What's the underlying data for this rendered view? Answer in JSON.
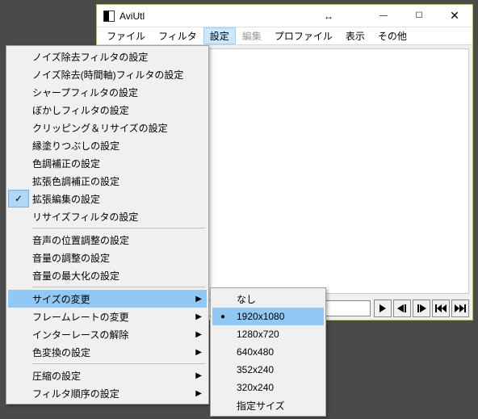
{
  "window": {
    "title": "AviUtl",
    "min_glyph": "—",
    "max_glyph": "☐",
    "close_glyph": "✕",
    "resize_glyph": "↔"
  },
  "menubar": {
    "items": [
      {
        "label": "ファイル",
        "disabled": false
      },
      {
        "label": "フィルタ",
        "disabled": false
      },
      {
        "label": "設定",
        "disabled": false,
        "active": true
      },
      {
        "label": "編集",
        "disabled": true
      },
      {
        "label": "プロファイル",
        "disabled": false
      },
      {
        "label": "表示",
        "disabled": false
      },
      {
        "label": "その他",
        "disabled": false
      }
    ]
  },
  "playback": {
    "play": "▶",
    "step_back": "◀|",
    "step_fwd": "|▶",
    "jump_start": "|◀",
    "jump_end": "▶|"
  },
  "dropdown": {
    "items": [
      {
        "label": "ノイズ除去フィルタの設定"
      },
      {
        "label": "ノイズ除去(時間軸)フィルタの設定"
      },
      {
        "label": "シャープフィルタの設定"
      },
      {
        "label": "ぼかしフィルタの設定"
      },
      {
        "label": "クリッピング＆リサイズの設定"
      },
      {
        "label": "縁塗りつぶしの設定"
      },
      {
        "label": "色調補正の設定"
      },
      {
        "label": "拡張色調補正の設定"
      },
      {
        "label": "拡張編集の設定",
        "checked": true
      },
      {
        "label": "リサイズフィルタの設定"
      },
      {
        "sep": true
      },
      {
        "label": "音声の位置調整の設定"
      },
      {
        "label": "音量の調整の設定"
      },
      {
        "label": "音量の最大化の設定"
      },
      {
        "sep": true
      },
      {
        "label": "サイズの変更",
        "submenu": true,
        "hover": true
      },
      {
        "label": "フレームレートの変更",
        "submenu": true
      },
      {
        "label": "インターレースの解除",
        "submenu": true
      },
      {
        "label": "色変換の設定",
        "submenu": true
      },
      {
        "sep": true
      },
      {
        "label": "圧縮の設定",
        "submenu": true
      },
      {
        "label": "フィルタ順序の設定",
        "submenu": true
      }
    ]
  },
  "submenu": {
    "items": [
      {
        "label": "なし"
      },
      {
        "label": "1920x1080",
        "hover": true,
        "bullet": true
      },
      {
        "label": "1280x720"
      },
      {
        "label": "640x480"
      },
      {
        "label": "352x240"
      },
      {
        "label": "320x240"
      },
      {
        "label": "指定サイズ"
      }
    ]
  }
}
